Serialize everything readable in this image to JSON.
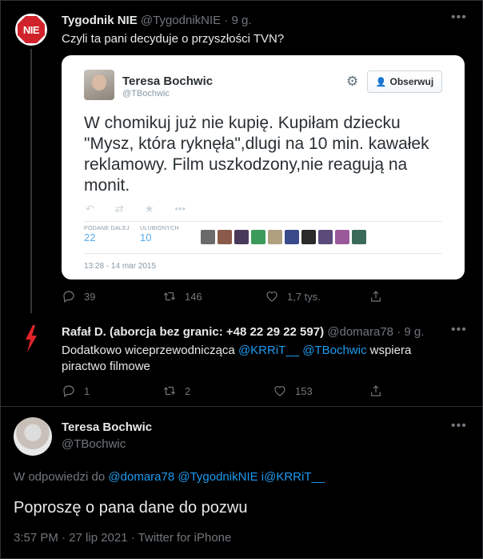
{
  "tweet1": {
    "avatar_text": "NIE",
    "name": "Tygodnik NIE",
    "handle": "@TygodnikNIE",
    "sep": "·",
    "time": "9 g.",
    "text": "Czyli ta pani decyduje o przyszłości TVN?",
    "embedded": {
      "name": "Teresa Bochwic",
      "handle": "@TBochwic",
      "follow_label": "Obserwuj",
      "text": "W chomikuj już nie kupię. Kupiłam dziecku \"Mysz, która ryknęła\",dlugi na 10 min. kawałek reklamowy. Film uszkodzony,nie reagują na monit.",
      "retweets_label": "PODANE DALEJ",
      "retweets_value": "22",
      "likes_label": "ULUBIONYCH",
      "likes_value": "10",
      "date": "13:28 - 14 mar 2015"
    },
    "replies": "39",
    "retweets": "146",
    "likes": "1,7 tys."
  },
  "tweet2": {
    "name": "Rafał D. (aborcja bez granic: +48 22 29 22 597)",
    "handle": "@domara78",
    "sep": "·",
    "time": "9 g.",
    "text_pre": "Dodatkowo wiceprzewodnicząca ",
    "mention1": "@KRRiT__",
    "mention2": "@TBochwic",
    "text_post": " wspiera piractwo filmowe",
    "replies": "1",
    "retweets": "2",
    "likes": "153"
  },
  "main": {
    "name": "Teresa Bochwic",
    "handle": "@TBochwic",
    "reply_prefix": "W odpowiedzi do",
    "reply_to": "@domara78 @TygodnikNIE i@KRRiT__",
    "text": "Poproszę o pana dane do pozwu",
    "meta": "3:57 PM · 27 lip 2021 · Twitter for iPhone"
  },
  "colors": {
    "background": "#000000",
    "link": "#1d9bf0",
    "muted": "#71767b",
    "nie_red": "#d0222a"
  }
}
